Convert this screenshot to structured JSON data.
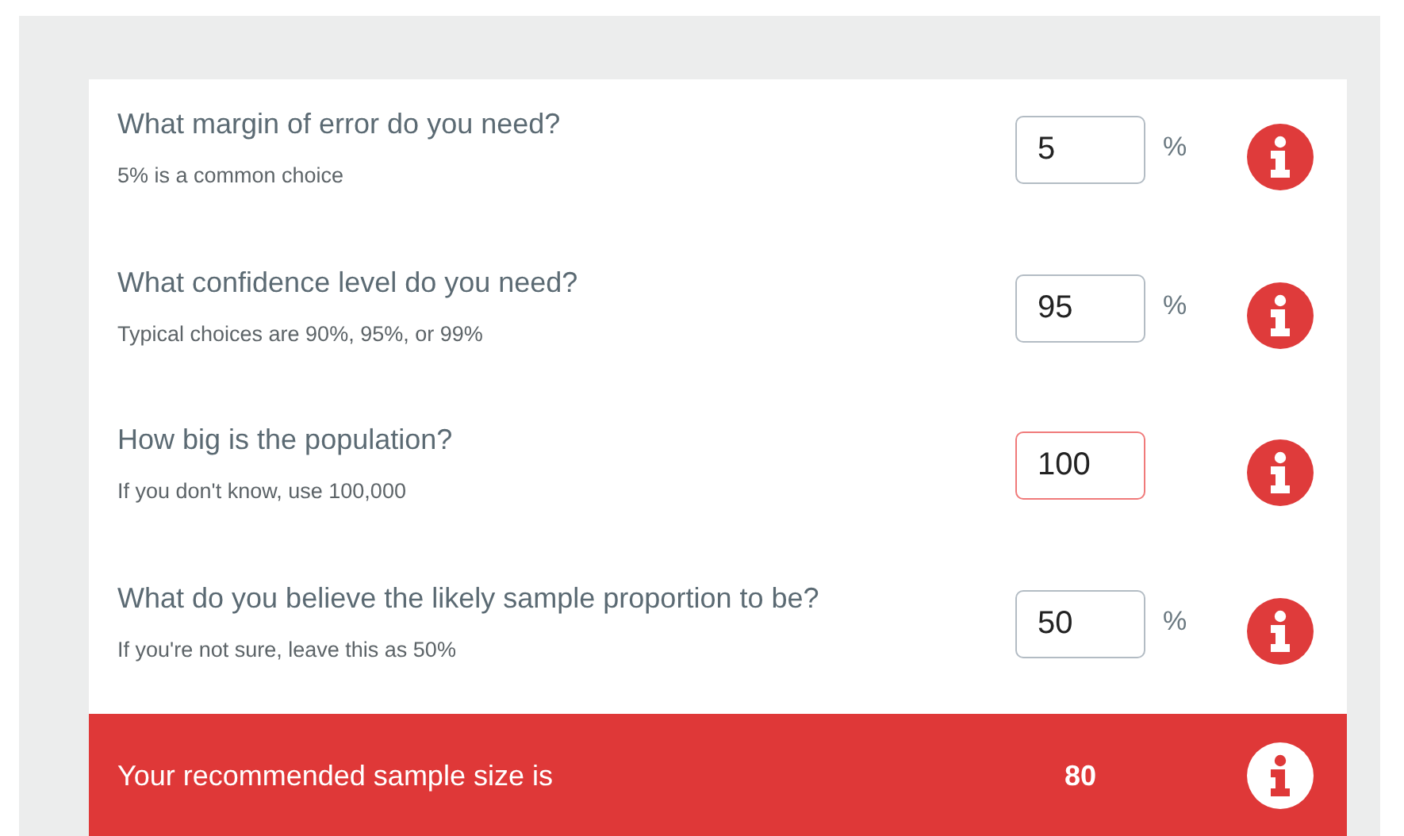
{
  "questions": [
    {
      "question": "What margin of error do you need?",
      "hint": "5% is a common choice",
      "value": "5",
      "unit": "%",
      "invalid": false
    },
    {
      "question": "What confidence level do you need?",
      "hint": "Typical choices are 90%, 95%, or 99%",
      "value": "95",
      "unit": "%",
      "invalid": false
    },
    {
      "question": "How big is the population?",
      "hint": "If you don't know, use 100,000",
      "value": "100",
      "invalid": true
    },
    {
      "question": "What do you believe the likely sample proportion to be?",
      "hint": "If you're not sure, leave this as 50%",
      "value": "50",
      "unit": "%",
      "invalid": false
    }
  ],
  "result": {
    "label": "Your recommended sample size is",
    "value": "80"
  }
}
